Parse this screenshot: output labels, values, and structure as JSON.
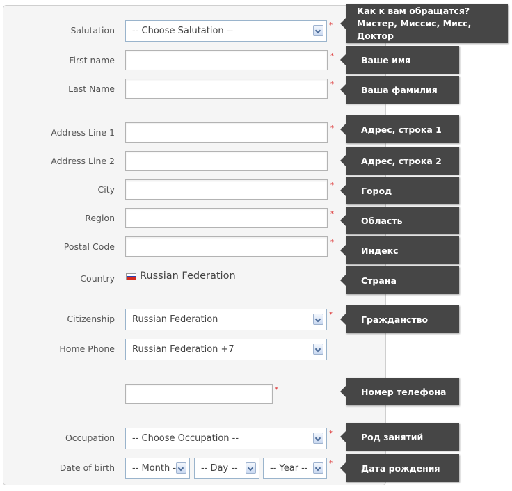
{
  "fields": {
    "salutation": {
      "label": "Salutation",
      "value": "-- Choose Salutation --",
      "required": "*",
      "tip_line1": "Как к вам обращатся?",
      "tip_line2": "Мистер, Миссис, Мисс, Доктор"
    },
    "first_name": {
      "label": "First name",
      "value": "",
      "required": "*",
      "tip": "Ваше имя"
    },
    "last_name": {
      "label": "Last Name",
      "value": "",
      "required": "*",
      "tip": "Ваша фамилия"
    },
    "address1": {
      "label": "Address Line 1",
      "value": "",
      "required": "*",
      "tip": "Адрес, строка 1"
    },
    "address2": {
      "label": "Address Line 2",
      "value": "",
      "tip": "Адрес, строка 2"
    },
    "city": {
      "label": "City",
      "value": "",
      "required": "*",
      "tip": "Город"
    },
    "region": {
      "label": "Region",
      "value": "",
      "required": "*",
      "tip": "Область"
    },
    "postal": {
      "label": "Postal Code",
      "value": "",
      "required": "*",
      "tip": "Индекс"
    },
    "country": {
      "label": "Country",
      "value": "Russian Federation",
      "tip": "Страна"
    },
    "citizenship": {
      "label": "Citizenship",
      "value": "Russian Federation",
      "required": "*",
      "tip": "Гражданство"
    },
    "home_phone": {
      "label": "Home Phone",
      "value": "Russian Federation +7"
    },
    "phone_number": {
      "value": "",
      "required": "*",
      "tip": "Номер телефона"
    },
    "occupation": {
      "label": "Occupation",
      "value": "-- Choose Occupation --",
      "required": "*",
      "tip": "Род занятий"
    },
    "dob": {
      "label": "Date of birth",
      "month": "-- Month -",
      "day": "-- Day --",
      "year": "-- Year --",
      "required": "*",
      "tip": "Дата рождения"
    }
  },
  "flag_colors": [
    "#ffffff",
    "#2a3fb0",
    "#d52b1e"
  ]
}
